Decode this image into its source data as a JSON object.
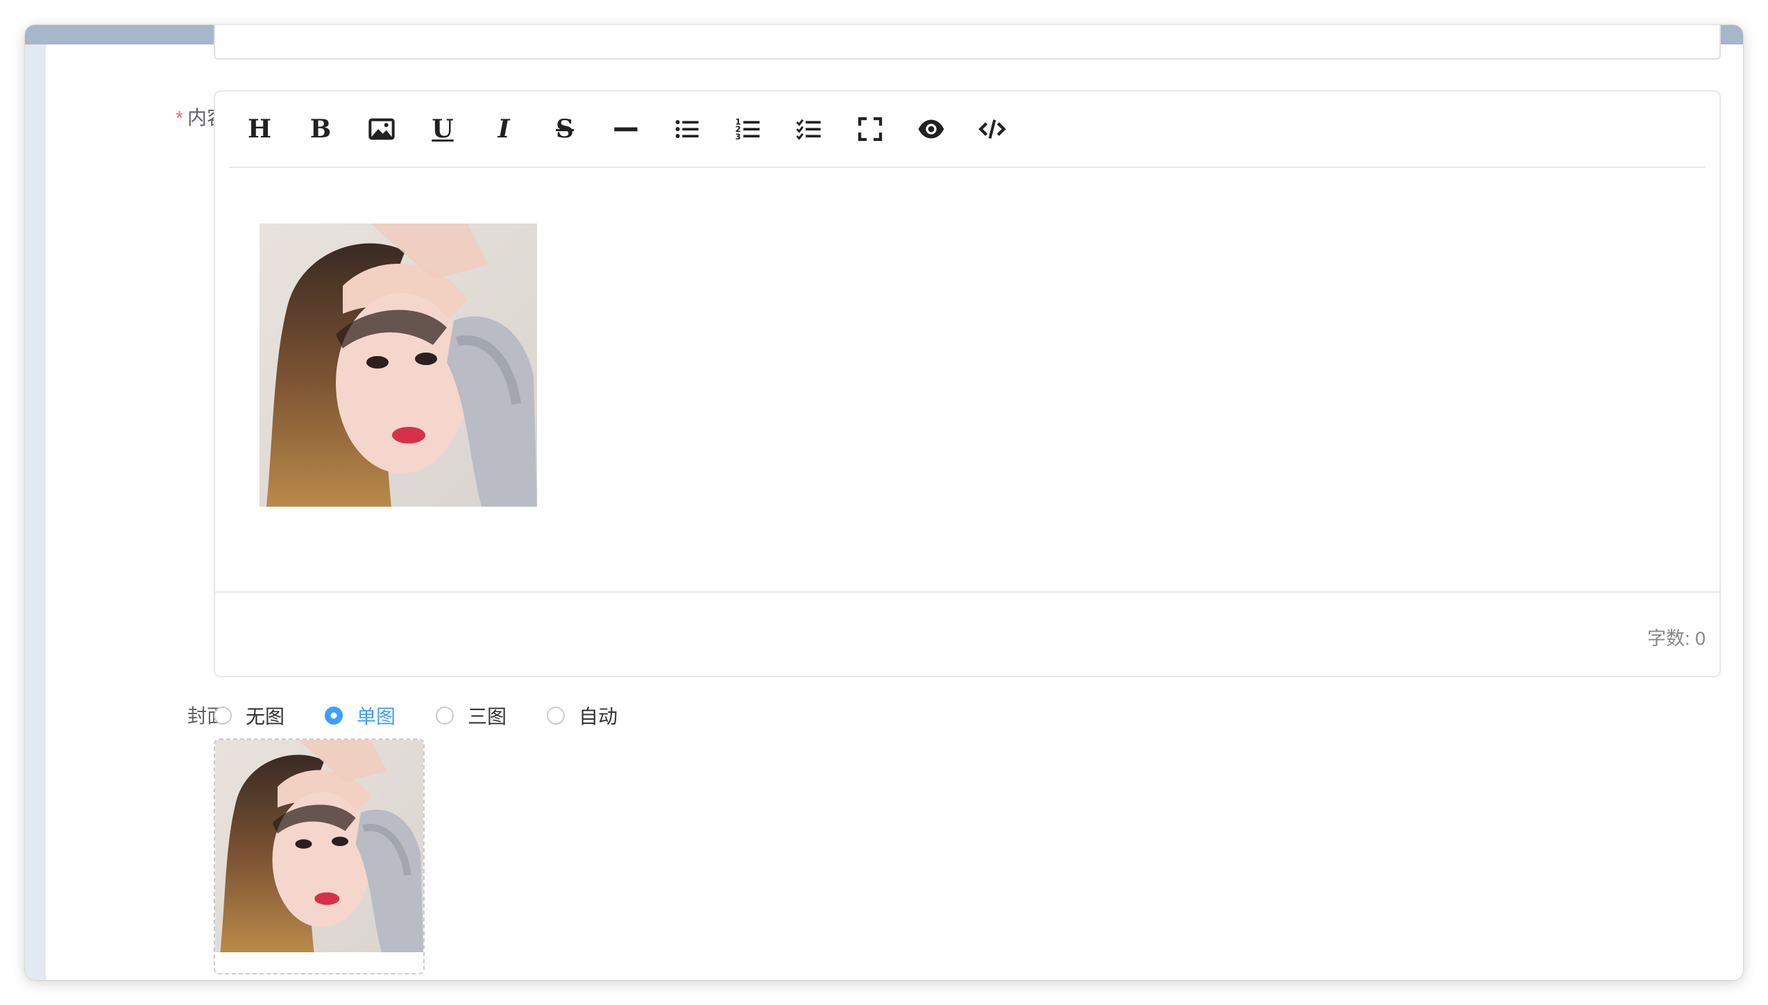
{
  "form": {
    "content_label": "内容",
    "required_mark": "*",
    "cover_label": "封面"
  },
  "toolbar": {
    "heading_glyph": "H",
    "bold_glyph": "B",
    "underline_glyph": "U",
    "italic_glyph": "I",
    "strike_glyph": "S"
  },
  "editor": {
    "word_count": "字数: 0"
  },
  "cover_options": {
    "none": "无图",
    "single": "单图",
    "three": "三图",
    "auto": "自动",
    "selected": "单图"
  },
  "colors": {
    "accent": "#409eff",
    "required": "#f56c6c",
    "top_bar": "#a6b6cb"
  }
}
